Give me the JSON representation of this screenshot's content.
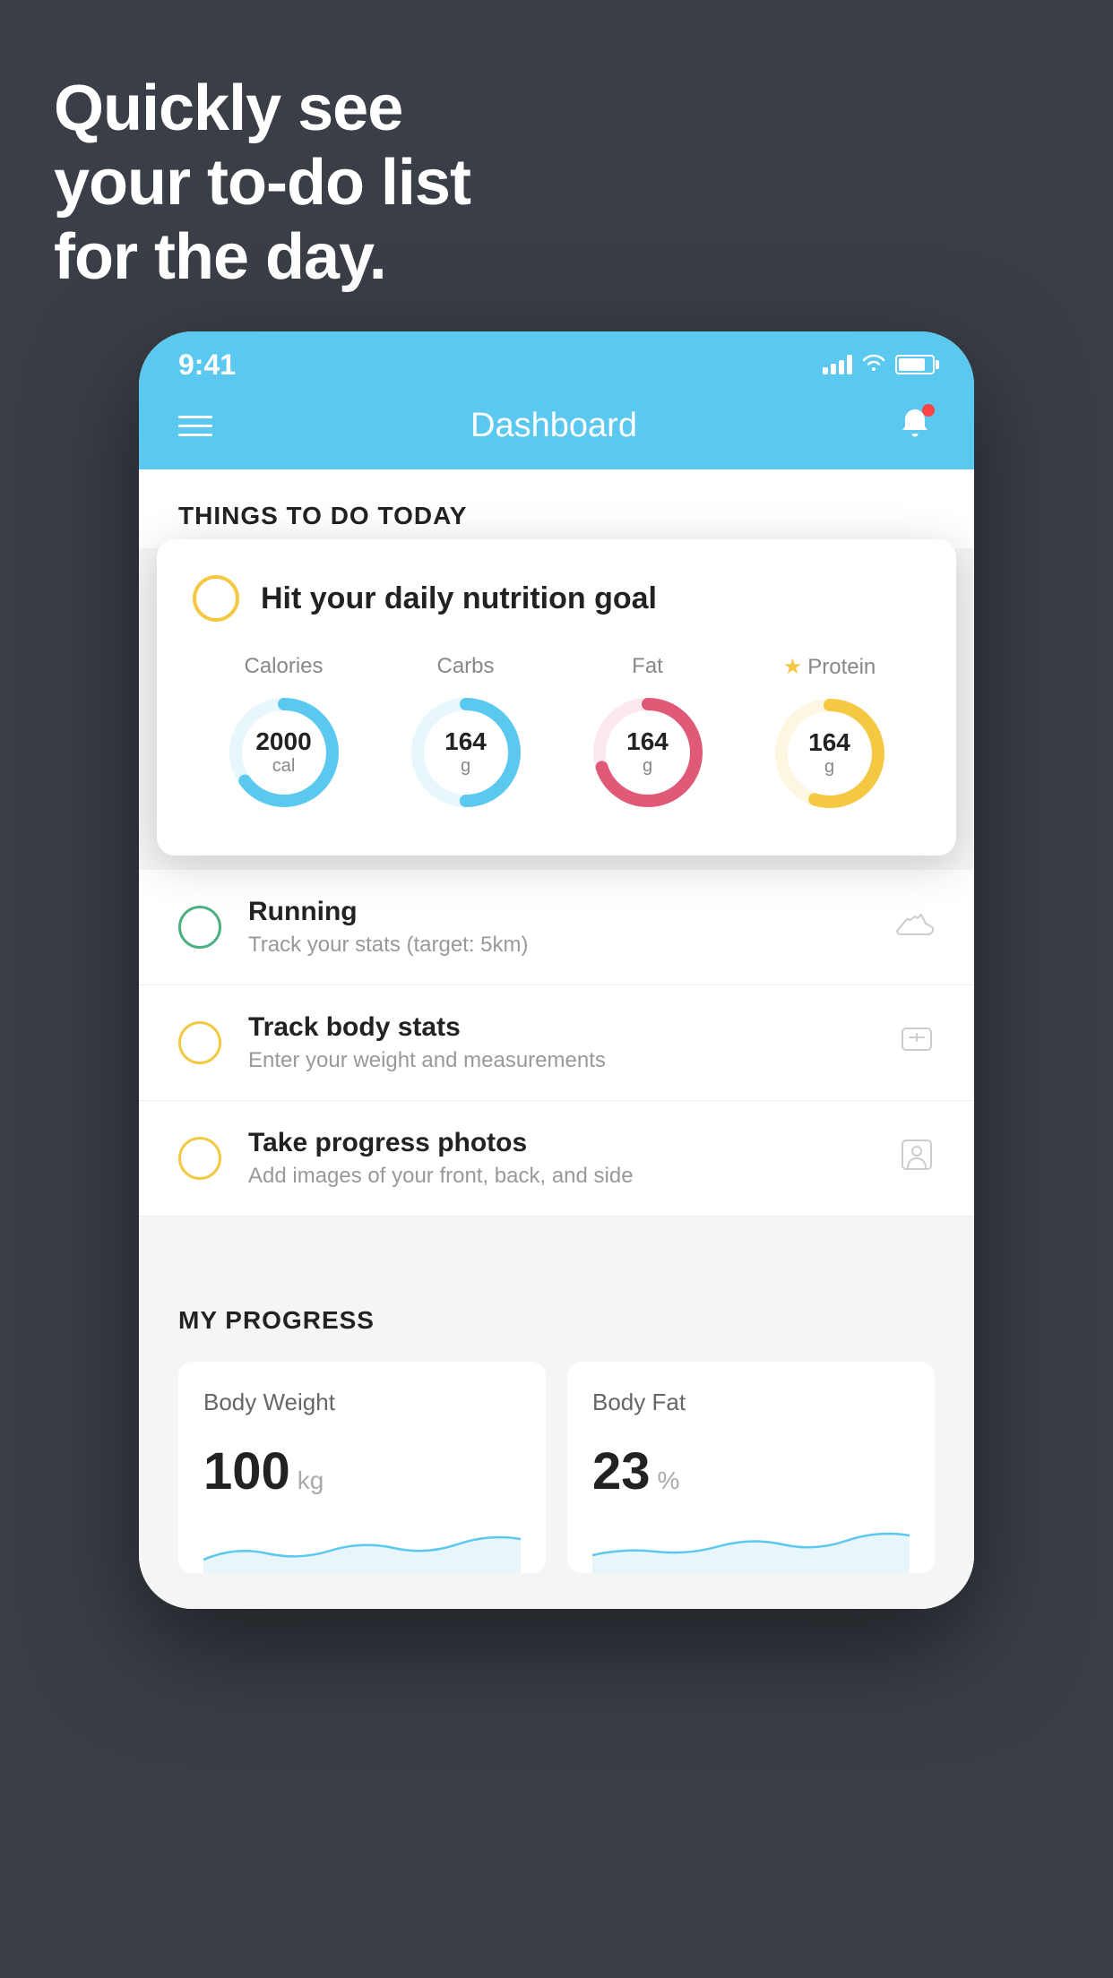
{
  "background_color": "#3a3f47",
  "headline": {
    "line1": "Quickly see",
    "line2": "your to-do list",
    "line3": "for the day."
  },
  "phone": {
    "status_bar": {
      "time": "9:41",
      "signal_bars": 4,
      "has_wifi": true,
      "battery_pct": 80
    },
    "header": {
      "title": "Dashboard",
      "has_notification": true
    },
    "section_label": "THINGS TO DO TODAY",
    "floating_card": {
      "check_color": "#f5c842",
      "title": "Hit your daily nutrition goal",
      "macros": [
        {
          "label": "Calories",
          "value": "2000",
          "unit": "cal",
          "color": "#5bc8f0",
          "bg": "#e8f7fc",
          "pct": 65,
          "star": false
        },
        {
          "label": "Carbs",
          "value": "164",
          "unit": "g",
          "color": "#5bc8f0",
          "bg": "#e8f7fc",
          "pct": 50,
          "star": false
        },
        {
          "label": "Fat",
          "value": "164",
          "unit": "g",
          "color": "#e05a78",
          "bg": "#fde8ed",
          "pct": 70,
          "star": false
        },
        {
          "label": "Protein",
          "value": "164",
          "unit": "g",
          "color": "#f5c842",
          "bg": "#fdf6e0",
          "pct": 55,
          "star": true
        }
      ]
    },
    "todo_items": [
      {
        "id": "running",
        "circle_color": "green",
        "title": "Running",
        "subtitle": "Track your stats (target: 5km)",
        "icon": "shoe"
      },
      {
        "id": "body-stats",
        "circle_color": "yellow",
        "title": "Track body stats",
        "subtitle": "Enter your weight and measurements",
        "icon": "scale"
      },
      {
        "id": "progress-photos",
        "circle_color": "yellow",
        "title": "Take progress photos",
        "subtitle": "Add images of your front, back, and side",
        "icon": "person"
      }
    ],
    "progress": {
      "label": "MY PROGRESS",
      "cards": [
        {
          "title": "Body Weight",
          "value": "100",
          "unit": "kg"
        },
        {
          "title": "Body Fat",
          "value": "23",
          "unit": "%"
        }
      ]
    }
  }
}
